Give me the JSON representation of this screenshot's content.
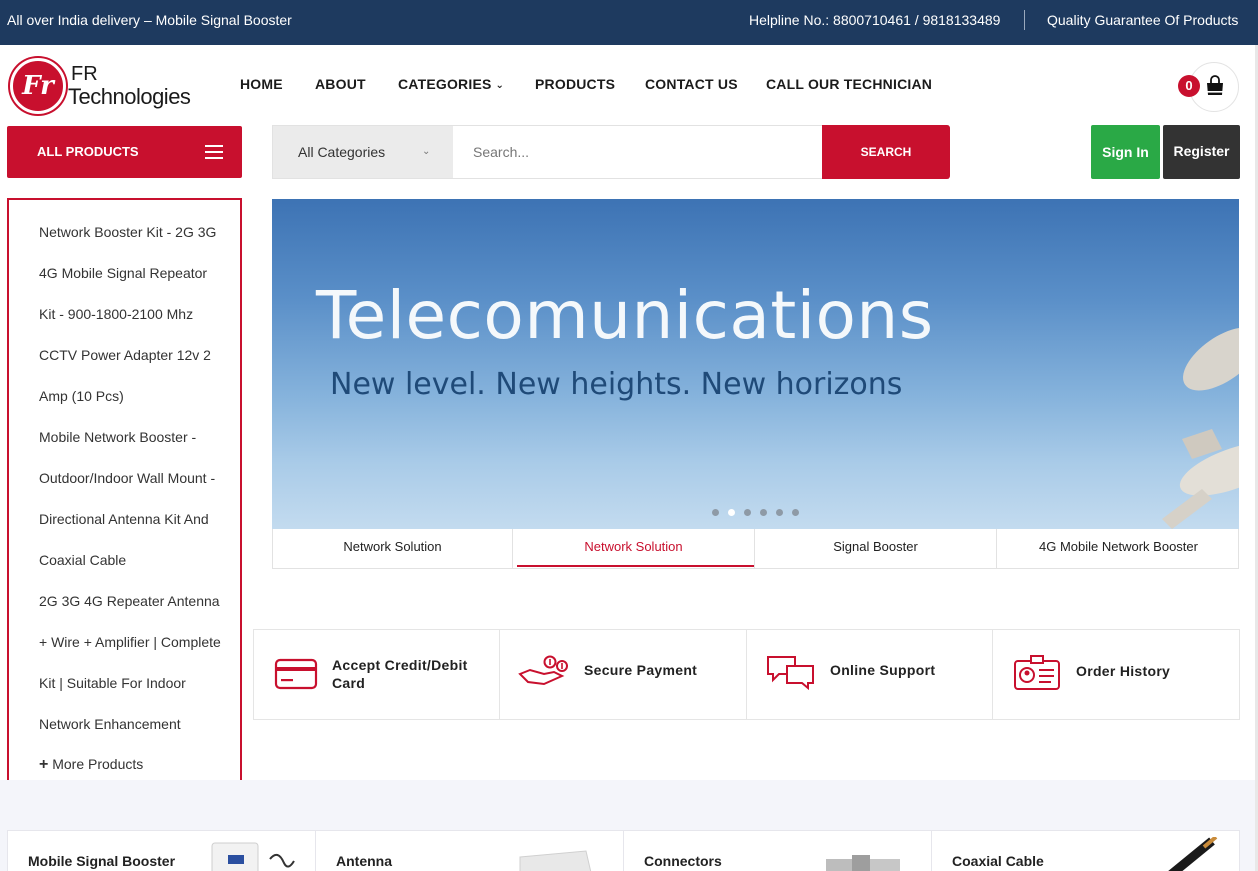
{
  "topbar": {
    "left_text": "All over India delivery – Mobile Signal Booster",
    "helpline": "Helpline No.: 8800710461 / 9818133489",
    "quality": "Quality Guarantee Of Products"
  },
  "logo": {
    "mark": "Fr",
    "line1": "FR",
    "line2": "Technologies"
  },
  "nav": {
    "home": "HOME",
    "about": "ABOUT",
    "categories": "CATEGORIES",
    "products": "PRODUCTS",
    "contact": "CONTACT US",
    "technician": "CALL OUR TECHNICIAN"
  },
  "cart": {
    "count": "0"
  },
  "all_products": {
    "label": "ALL PRODUCTS"
  },
  "search": {
    "category": "All Categories",
    "placeholder": "Search...",
    "button": "SEARCH"
  },
  "auth": {
    "signin": "Sign In",
    "register": "Register"
  },
  "sidebar": {
    "lines": [
      "Network Booster Kit - 2G 3G",
      "4G Mobile Signal Repeator",
      "Kit - 900-1800-2100 Mhz",
      "CCTV Power Adapter 12v 2",
      "Amp (10 Pcs)",
      "Mobile Network Booster -",
      "Outdoor/Indoor Wall Mount -",
      "Directional Antenna Kit And",
      "Coaxial Cable",
      "2G 3G 4G Repeater Antenna",
      "+ Wire + Amplifier | Complete",
      "Kit | Suitable For Indoor",
      "Network Enhancement"
    ],
    "more": "More Products"
  },
  "banner": {
    "title": "Telecomunications",
    "subtitle": "New level. New heights. New horizons",
    "slide_count": 6,
    "active_slide": 2
  },
  "banner_tabs": [
    "Network Solution",
    "Network Solution",
    "Signal Booster",
    "4G Mobile Network Booster"
  ],
  "features": {
    "card_line1": "Accept Credit/Debit",
    "card_line2": "Card",
    "payment": "Secure Payment",
    "support": "Online Support",
    "history": "Order History"
  },
  "categories": {
    "booster": "Mobile Signal Booster",
    "antenna": "Antenna",
    "connectors": "Connectors",
    "cable": "Coaxial Cable"
  },
  "colors": {
    "brand_red": "#c8102e",
    "topbar_navy": "#1e3a5f",
    "signin_green": "#2aa946",
    "register_dark": "#333333"
  }
}
